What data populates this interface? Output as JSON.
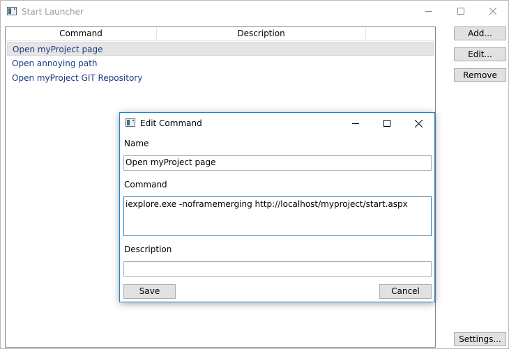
{
  "main_window": {
    "title": "Start Launcher",
    "list": {
      "columns": [
        "Command",
        "Description"
      ],
      "rows": [
        {
          "command": "Open myProject page",
          "selected": true
        },
        {
          "command": "Open annoying path",
          "selected": false
        },
        {
          "command": "Open myProject GIT Repository",
          "selected": false
        }
      ]
    },
    "buttons": {
      "add": "Add...",
      "edit": "Edit...",
      "remove": "Remove",
      "settings": "Settings..."
    }
  },
  "dialog": {
    "title": "Edit Command",
    "name_label": "Name",
    "name_value": "Open myProject page",
    "command_label": "Command",
    "command_value": "iexplore.exe -noframemerging http://localhost/myproject/start.aspx",
    "description_label": "Description",
    "description_value": "",
    "save": "Save",
    "cancel": "Cancel"
  },
  "colors": {
    "selection": "#e5e5e5",
    "list_text": "#1a3b83",
    "dialog_border": "#1883d7",
    "inactive_title": "#9a9a9a"
  },
  "icons": [
    "app-icon",
    "minimize-icon",
    "maximize-icon",
    "close-icon"
  ]
}
